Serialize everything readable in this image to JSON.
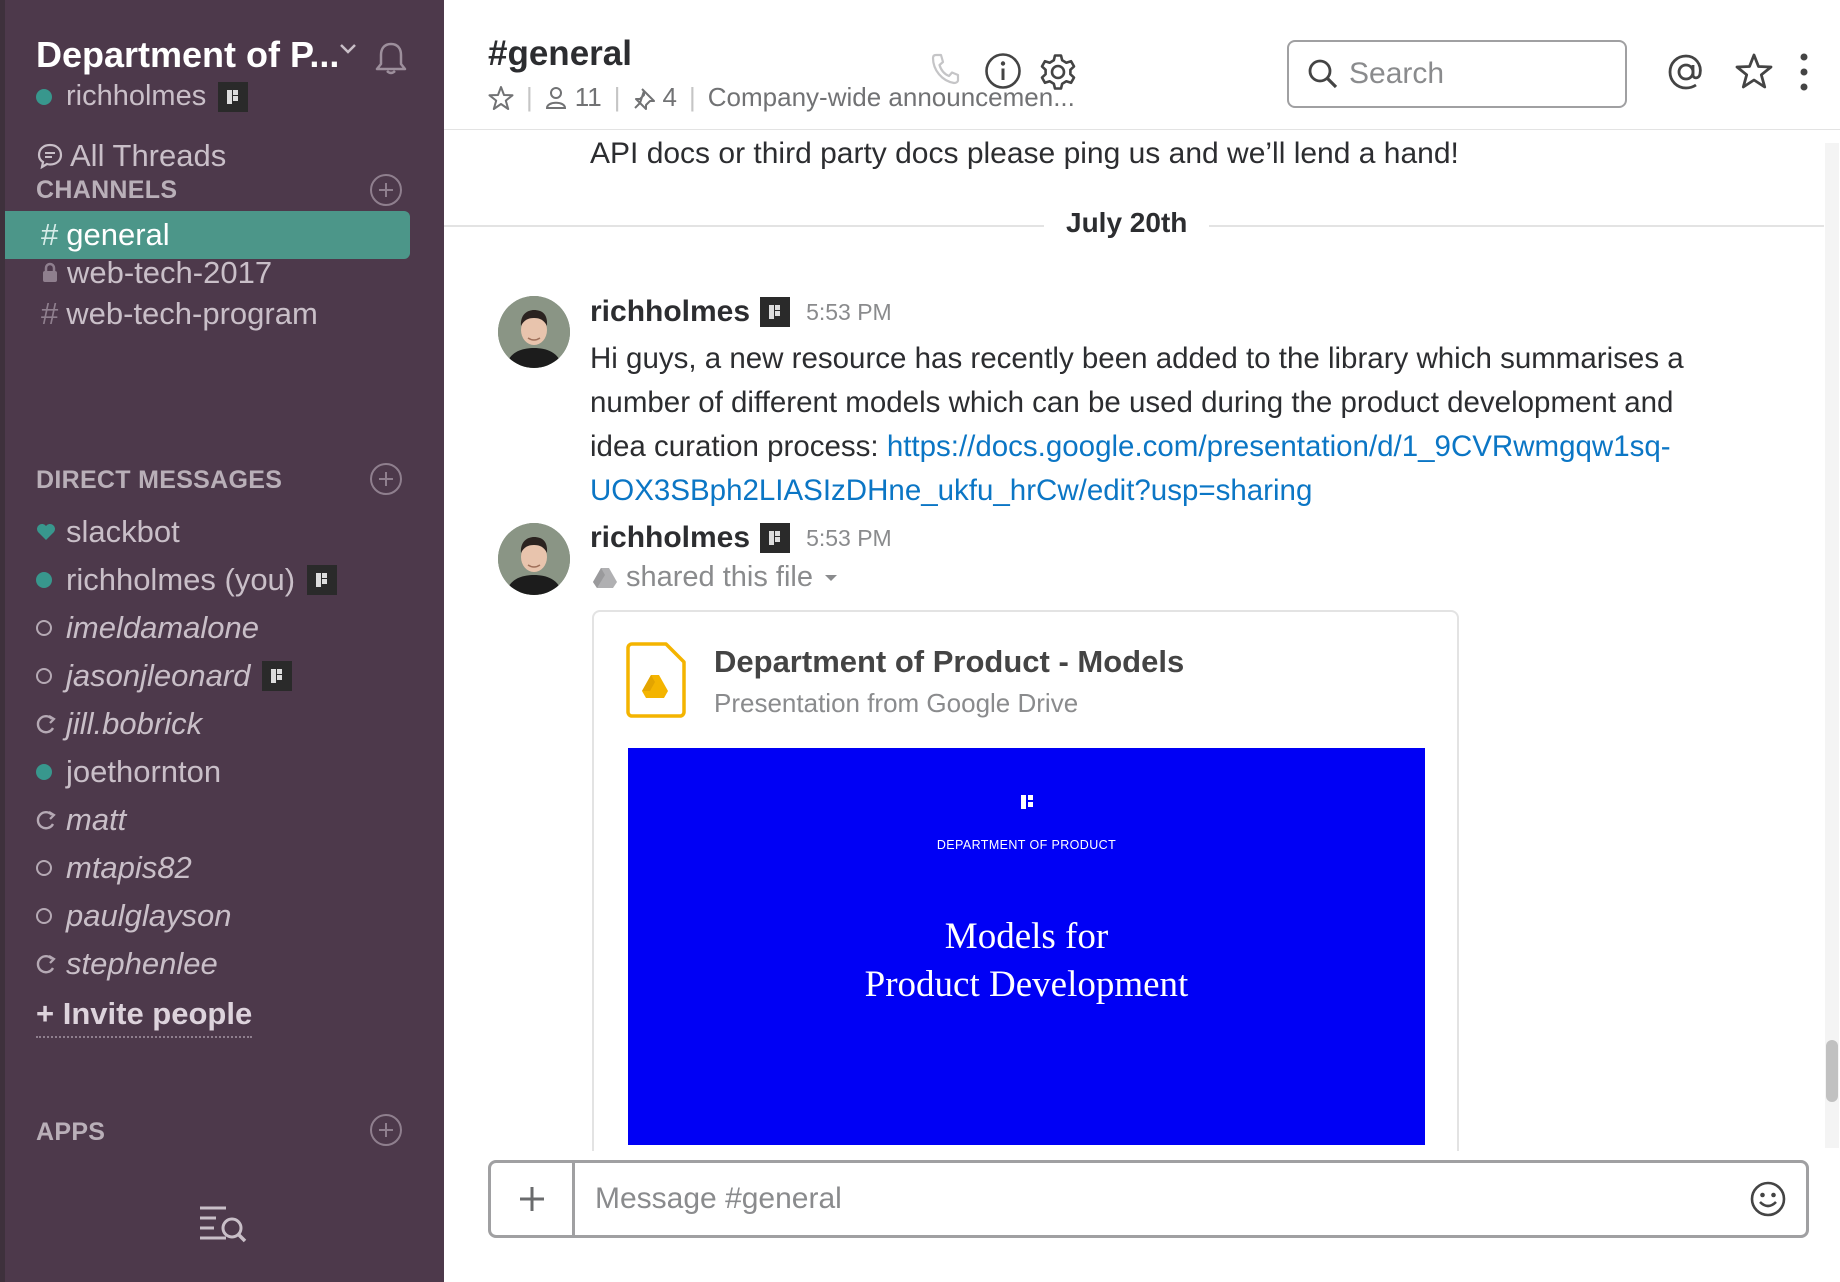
{
  "sidebar": {
    "team_name": "Department of P...",
    "current_user": "richholmes",
    "all_threads": "All Threads",
    "channels_heading": "CHANNELS",
    "channels": [
      {
        "prefix": "#",
        "name": "general",
        "active": true
      },
      {
        "prefix": "lock",
        "name": "web-tech-2017",
        "active": false
      },
      {
        "prefix": "#",
        "name": "web-tech-program",
        "active": false
      }
    ],
    "dm_heading": "DIRECT MESSAGES",
    "dms": [
      {
        "name": "slackbot",
        "status": "heart"
      },
      {
        "name": "richholmes (you)",
        "status": "online"
      },
      {
        "name": "imeldamalone",
        "status": "away"
      },
      {
        "name": "jasonjleonard",
        "status": "away"
      },
      {
        "name": "jill.bobrick",
        "status": "shared"
      },
      {
        "name": "joethornton",
        "status": "online"
      },
      {
        "name": "matt",
        "status": "shared"
      },
      {
        "name": "mtapis82",
        "status": "away"
      },
      {
        "name": "paulglayson",
        "status": "away"
      },
      {
        "name": "stephenlee",
        "status": "shared"
      }
    ],
    "invite": "Invite people",
    "apps_heading": "APPS"
  },
  "header": {
    "channel_title": "#general",
    "members_count": "11",
    "pins_count": "4",
    "topic": "Company-wide announcemen...",
    "search_placeholder": "Search"
  },
  "messages": {
    "previous_tail": "API docs or third party docs please ping us and we’ll lend a hand!",
    "day_divider": "July 20th",
    "items": [
      {
        "author": "richholmes",
        "time": "5:53 PM",
        "text": "Hi guys, a new resource has recently been added to the library which summarises a number of different models which can be used during the product development and idea curation process: ",
        "link": "https://docs.google.com/presentation/d/1_9CVRwmgqw1sq-UOX3SBph2LIASIzDHne_ukfu_hrCw/edit?usp=sharing"
      },
      {
        "author": "richholmes",
        "time": "5:53 PM",
        "shared_label": "shared this file",
        "file": {
          "title": "Department of Product - Models",
          "subtitle": "Presentation from Google Drive",
          "preview_org": "DEPARTMENT OF PRODUCT",
          "preview_title_line1": "Models for",
          "preview_title_line2": "Product Development"
        }
      }
    ]
  },
  "composer": {
    "placeholder": "Message #general"
  },
  "colors": {
    "sidebar_bg": "#4d394b",
    "active_channel": "#4c9689",
    "online": "#38978d",
    "link": "#0b76c5",
    "preview_bg": "#0000f5"
  }
}
